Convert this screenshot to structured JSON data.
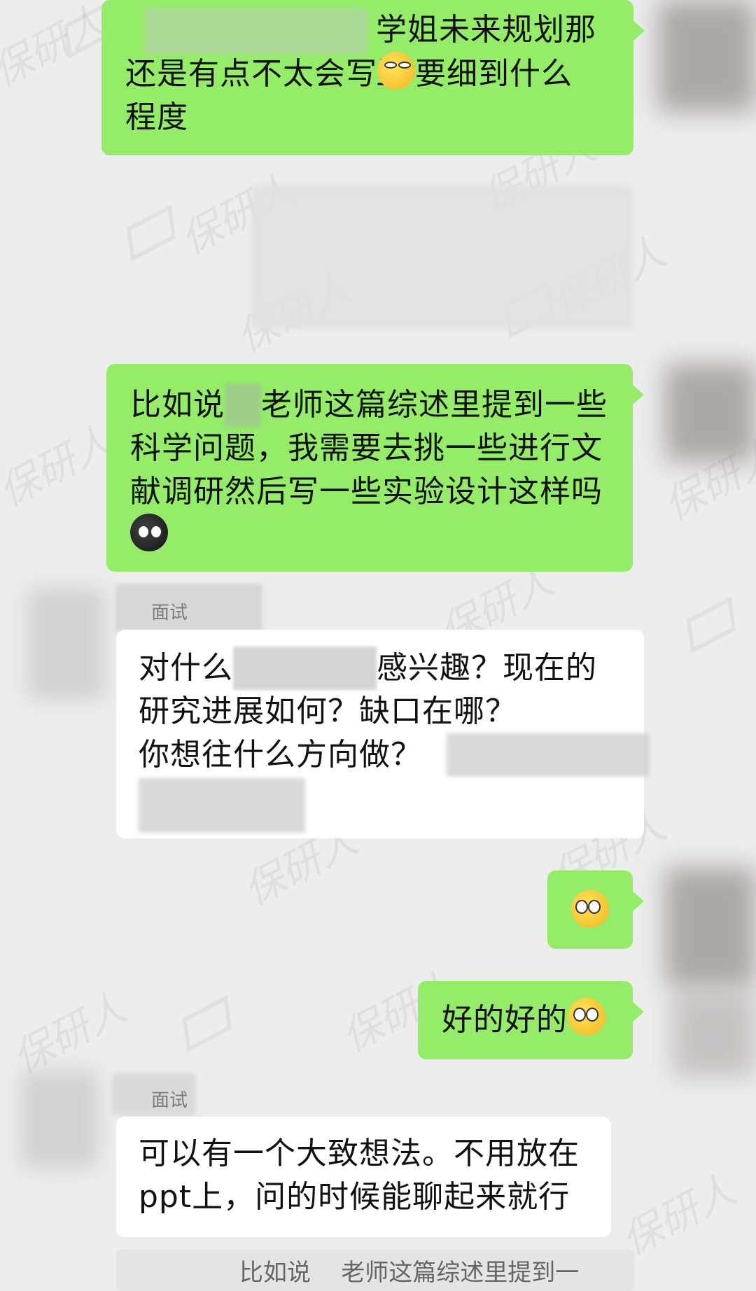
{
  "messages": [
    {
      "line1": "学姐未来规划那里",
      "line2": "还是有点不太会写",
      "line2b": "要细到什么",
      "line3": "程度"
    },
    {
      "line1a": "比如说",
      "line1b": "老师这篇综述里提到一些",
      "line2": "科学问题，我需要去挑一些进行文",
      "line3": "献调研然后写一些实验设计这样吗"
    },
    {
      "sender": "面试",
      "line1a": "对什么",
      "line1b": "感兴趣？现在的",
      "line2": "研究进展如何？缺口在哪？",
      "line3": "你想往什么方向做？"
    },
    {
      "text": "好的好的"
    },
    {
      "sender": "面试",
      "line1": "可以有一个大致想法。不用放在",
      "line2": "ppt上，问的时候能聊起来就行"
    },
    {
      "partial": "比如说    老师这篇综述里提到一"
    }
  ],
  "watermark": "保研人",
  "icons": {
    "grimace": "grimace-emoji-icon",
    "crying": "crying-emoji-icon",
    "peek": "peek-emoji-icon",
    "ok": "ok-hand-emoji-icon"
  },
  "colors": {
    "mine": "#95ec69",
    "theirs": "#ffffff",
    "background": "#ededed"
  }
}
